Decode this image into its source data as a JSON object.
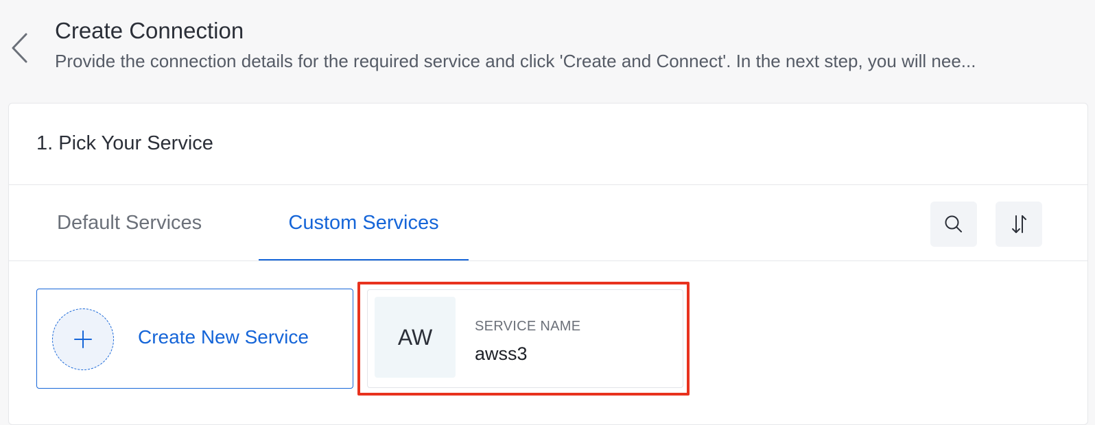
{
  "header": {
    "title": "Create Connection",
    "description": "Provide the connection details for the required service and click 'Create and Connect'. In the next step, you will nee..."
  },
  "step": {
    "title": "1. Pick Your Service"
  },
  "tabs": [
    {
      "label": "Default Services",
      "active": false
    },
    {
      "label": "Custom Services",
      "active": true
    }
  ],
  "toolbar": {
    "search_icon": "search-icon",
    "sort_icon": "sort-icon"
  },
  "create_card": {
    "label": "Create New Service",
    "icon": "plus-icon"
  },
  "service_card": {
    "avatar_text": "AW",
    "caption": "SERVICE NAME",
    "name": "awss3",
    "highlighted": true
  },
  "colors": {
    "accent": "#1565d8",
    "highlight": "#e8321e",
    "text": "#2b2f38",
    "muted": "#6b7079"
  }
}
